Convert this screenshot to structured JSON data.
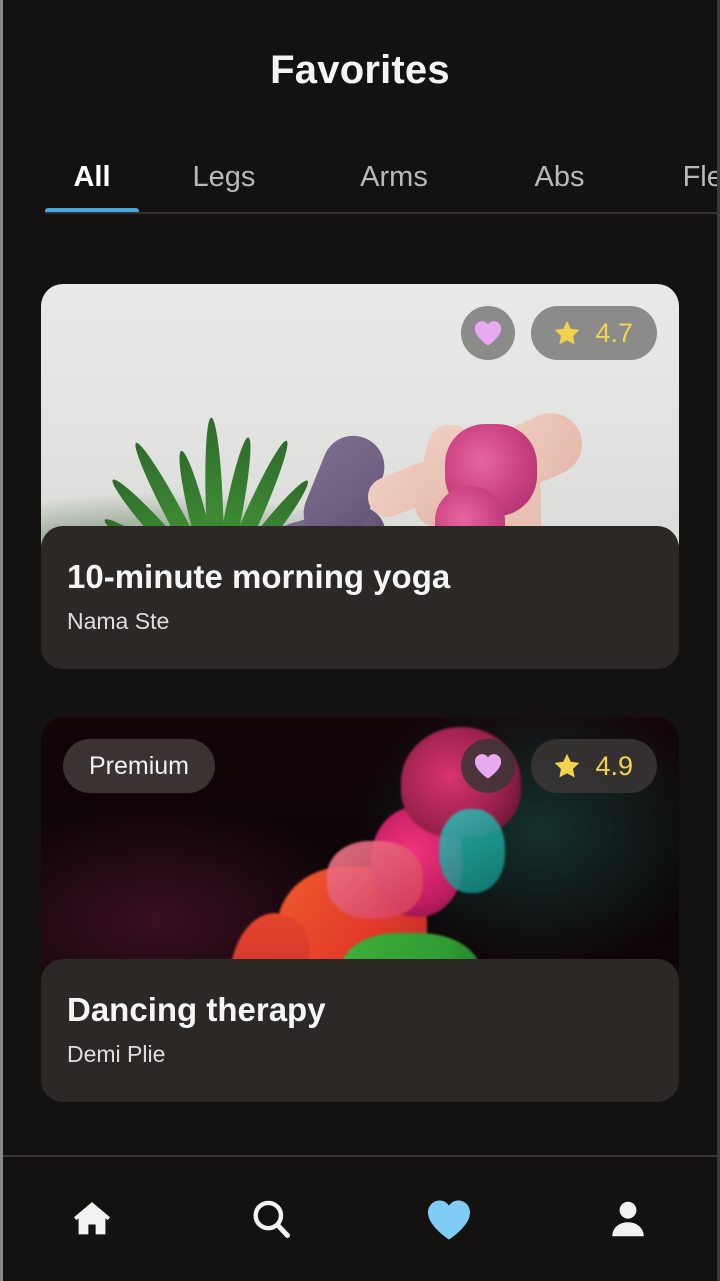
{
  "header": {
    "title": "Favorites"
  },
  "tabs": {
    "active_index": 0,
    "accent_color": "#4ba7dd",
    "items": [
      {
        "label": "All"
      },
      {
        "label": "Legs"
      },
      {
        "label": "Arms"
      },
      {
        "label": "Abs"
      },
      {
        "label": "Flex"
      }
    ]
  },
  "cards": [
    {
      "title": "10-minute morning yoga",
      "subtitle": "Nama Ste",
      "rating": "4.7",
      "premium_label": "",
      "has_premium": false,
      "favorited": true,
      "heart_color": "#e7a9ef",
      "star_color": "#f2d24f",
      "rating_color": "#f2d24f"
    },
    {
      "title": "Dancing therapy",
      "subtitle": "Demi Plie",
      "rating": "4.9",
      "premium_label": "Premium",
      "has_premium": true,
      "favorited": true,
      "heart_color": "#e7a9ef",
      "star_color": "#f2d24f",
      "rating_color": "#f2d24f"
    }
  ],
  "bottom_nav": {
    "active_index": 2,
    "active_color": "#7fcdf5",
    "inactive_color": "#f2f2f2",
    "items": [
      {
        "icon": "home-icon",
        "label": "Home"
      },
      {
        "icon": "search-icon",
        "label": "Search"
      },
      {
        "icon": "heart-icon",
        "label": "Favorites"
      },
      {
        "icon": "person-icon",
        "label": "Profile"
      }
    ]
  }
}
